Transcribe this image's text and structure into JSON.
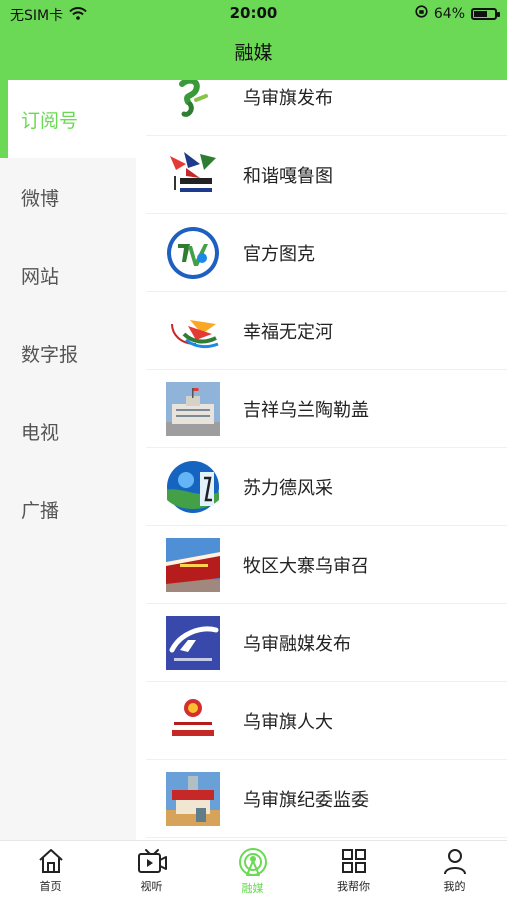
{
  "status_bar": {
    "carrier": "无SIM卡",
    "time": "20:00",
    "battery": "64%",
    "battery_level": 0.64
  },
  "header": {
    "title": "融媒"
  },
  "sidebar": {
    "items": [
      {
        "label": "订阅号",
        "active": true
      },
      {
        "label": "微博"
      },
      {
        "label": "网站"
      },
      {
        "label": "数字报"
      },
      {
        "label": "电视"
      },
      {
        "label": "广播"
      }
    ]
  },
  "list": {
    "items": [
      {
        "label": "乌审旗发布",
        "icon": "wushen-fabu-logo"
      },
      {
        "label": "和谐嘎鲁图",
        "icon": "galuut-logo"
      },
      {
        "label": "官方图克",
        "icon": "tuke-tv-logo"
      },
      {
        "label": "幸福无定河",
        "icon": "wudinghe-logo"
      },
      {
        "label": "吉祥乌兰陶勒盖",
        "icon": "building-photo"
      },
      {
        "label": "苏力德风采",
        "icon": "suld-logo"
      },
      {
        "label": "牧区大寨乌审召",
        "icon": "gate-photo"
      },
      {
        "label": "乌审融媒发布",
        "icon": "wushen-tv-logo"
      },
      {
        "label": "乌审旗人大",
        "icon": "renda-logo"
      },
      {
        "label": "乌审旗纪委监委",
        "icon": "jiwei-photo"
      }
    ]
  },
  "tabbar": {
    "items": [
      {
        "label": "首页",
        "icon": "home-icon"
      },
      {
        "label": "视听",
        "icon": "tv-icon"
      },
      {
        "label": "融媒",
        "icon": "broadcast-icon",
        "active": true
      },
      {
        "label": "我帮你",
        "icon": "grid-icon"
      },
      {
        "label": "我的",
        "icon": "person-icon"
      }
    ]
  },
  "colors": {
    "accent": "#6bd955",
    "sidebar_bg": "#f6f6f6"
  }
}
